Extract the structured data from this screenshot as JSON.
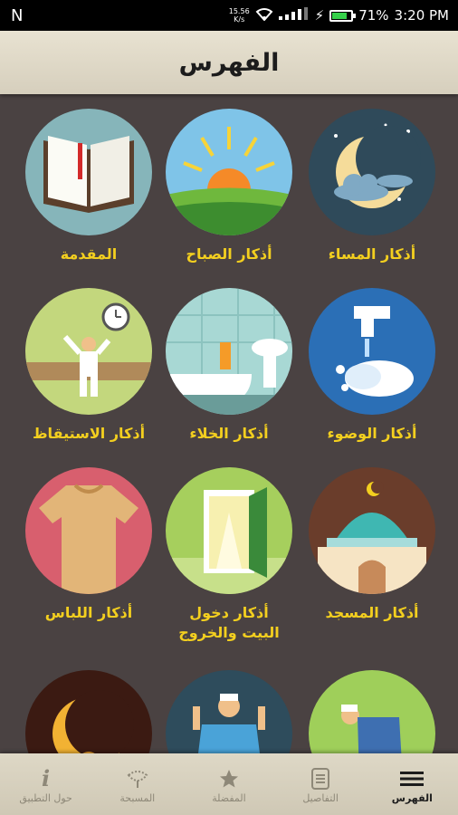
{
  "status_bar": {
    "carrier_icon": "N",
    "net_speed": "15.56",
    "net_unit": "K/s",
    "battery_percent": "71%",
    "battery_level": 0.71,
    "time": "3:20 PM"
  },
  "header": {
    "title": "الفهرس"
  },
  "tiles": [
    {
      "label": "أذكار المساء",
      "icon": "moon-night-icon"
    },
    {
      "label": "أذكار الصباح",
      "icon": "sunrise-icon"
    },
    {
      "label": "المقدمة",
      "icon": "open-book-icon"
    },
    {
      "label": "أذكار الوضوء",
      "icon": "faucet-hands-icon"
    },
    {
      "label": "أذكار الخلاء",
      "icon": "bathroom-icon"
    },
    {
      "label": "أذكار الاستيقاظ",
      "icon": "waking-up-icon"
    },
    {
      "label": "أذكار المسجد",
      "icon": "mosque-icon"
    },
    {
      "label_line1": "أذكار دخول",
      "label_line2": "البيت والخروج",
      "icon": "door-icon"
    },
    {
      "label": "أذكار اللباس",
      "icon": "shirt-icon"
    },
    {
      "icon": "praying-man-icon"
    },
    {
      "icon": "supplicating-man-icon"
    },
    {
      "icon": "crescent-city-icon"
    }
  ],
  "bottom_nav": [
    {
      "label": "الفهرس",
      "icon": "menu-icon",
      "active": true
    },
    {
      "label": "التفاصيل",
      "icon": "details-icon",
      "active": false
    },
    {
      "label": "المفضلة",
      "icon": "star-icon",
      "active": false
    },
    {
      "label": "المسبحة",
      "icon": "tasbih-icon",
      "active": false
    },
    {
      "label": "حول التطبيق",
      "icon": "info-icon",
      "active": false
    }
  ]
}
